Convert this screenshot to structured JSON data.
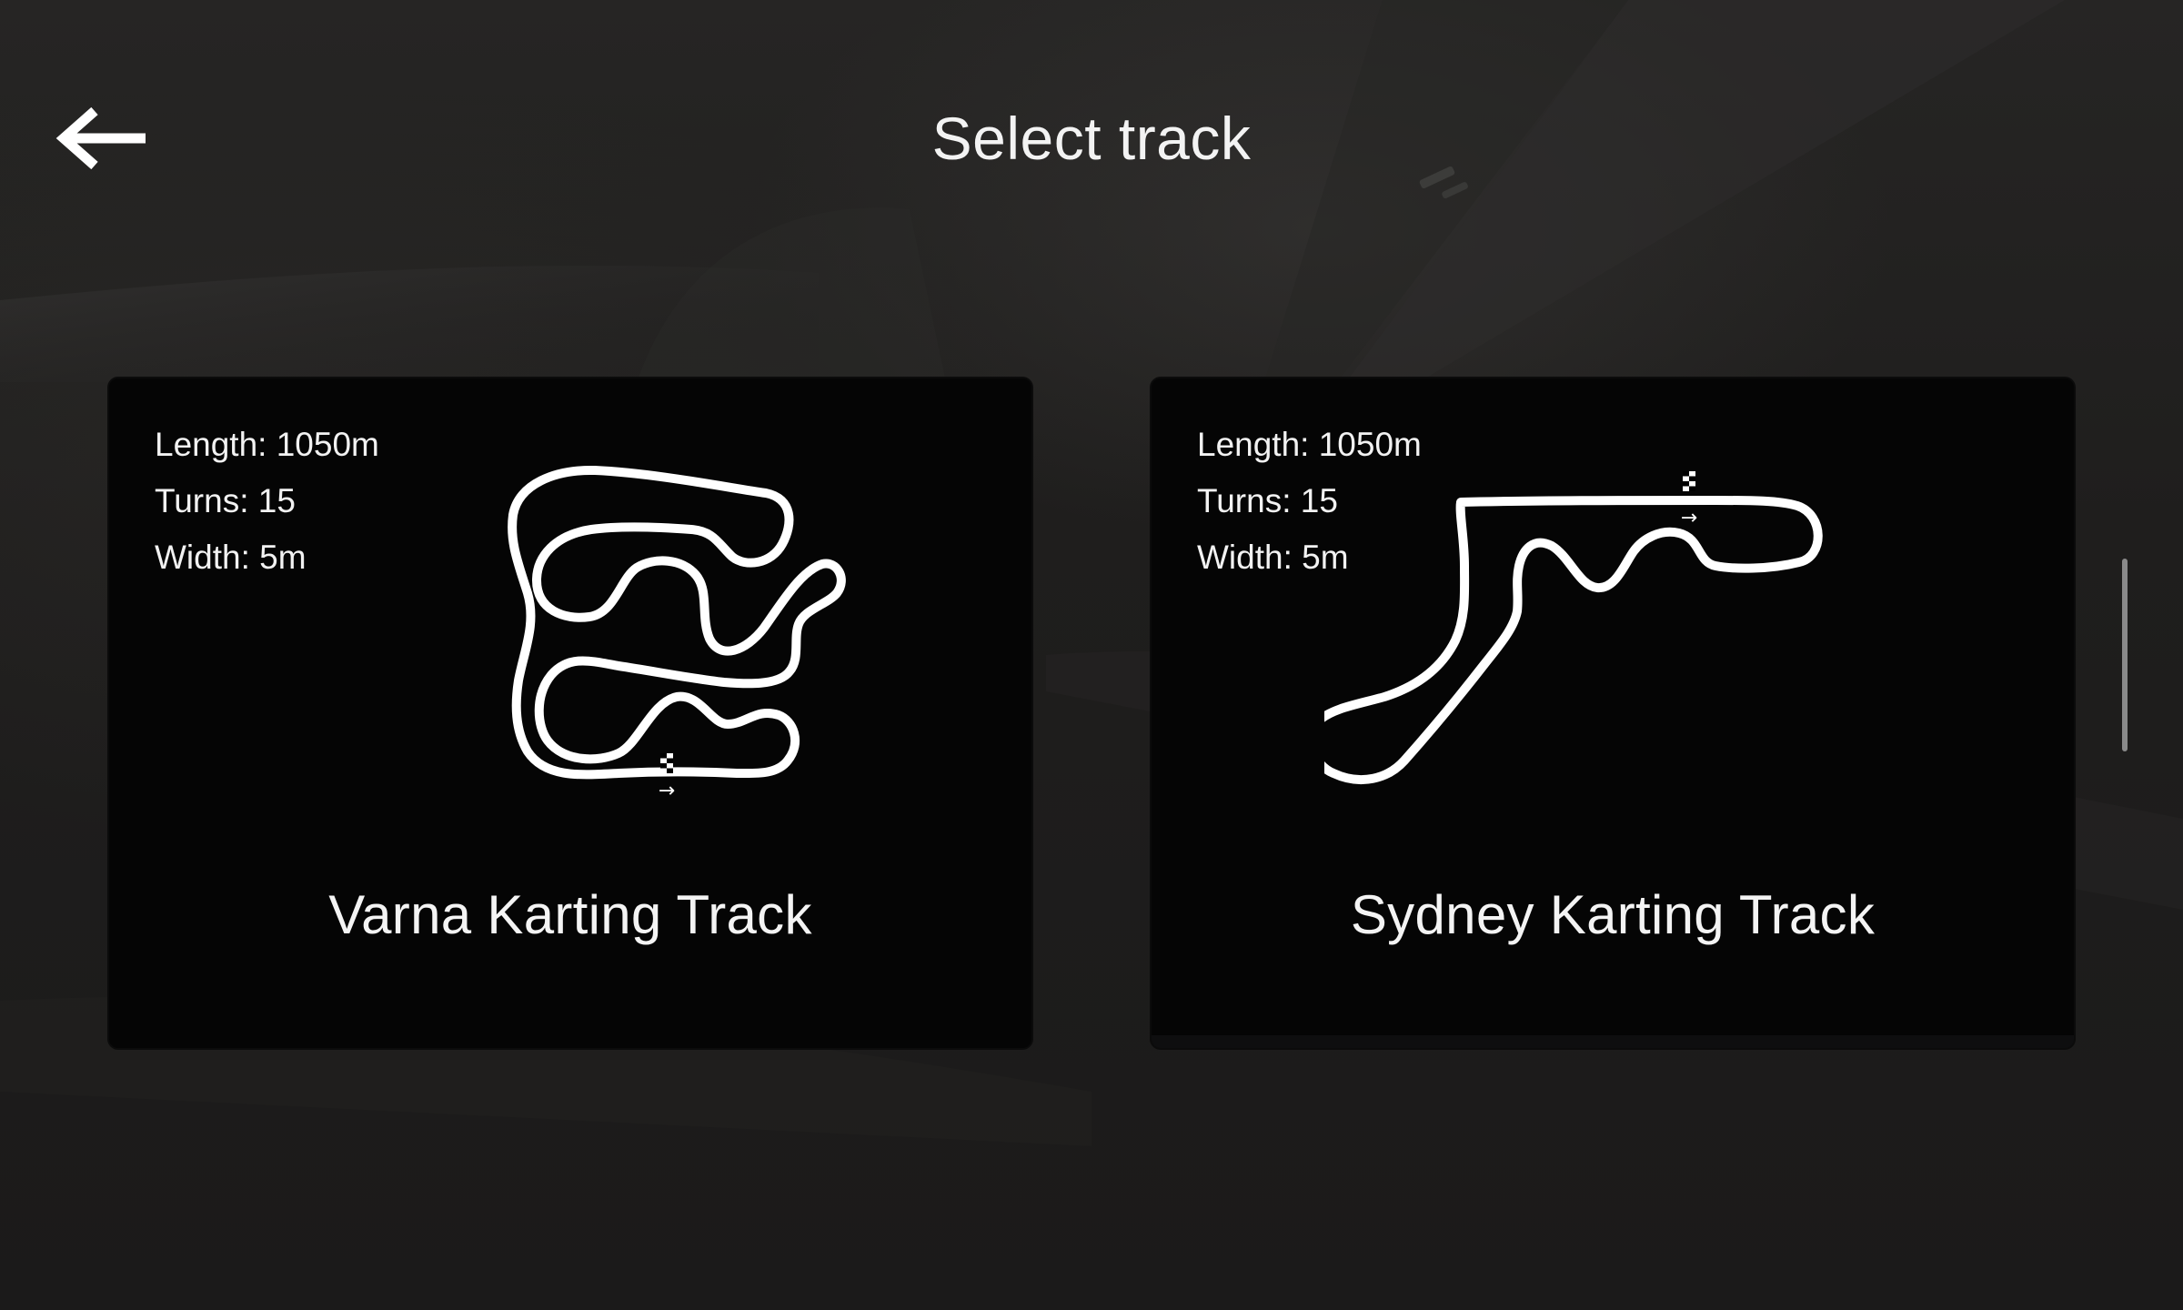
{
  "header": {
    "title": "Select track",
    "back_icon": "arrow-left-icon"
  },
  "tracks": [
    {
      "name": "Varna Karting Track",
      "stats": [
        {
          "label": "Length",
          "value": "1050m"
        },
        {
          "label": "Turns",
          "value": "15"
        },
        {
          "label": "Width",
          "value": "5m"
        }
      ],
      "start_arrow": "→",
      "start_flag_icon": "checkered-flag-icon"
    },
    {
      "name": "Sydney Karting Track",
      "stats": [
        {
          "label": "Length",
          "value": "1050m"
        },
        {
          "label": "Turns",
          "value": "15"
        },
        {
          "label": "Width",
          "value": "5m"
        }
      ],
      "start_arrow": "→",
      "start_flag_icon": "checkered-flag-icon"
    }
  ],
  "colors": {
    "background": "#1e1d1d",
    "card": "#050505",
    "text": "#ffffff",
    "track_line": "#ffffff"
  }
}
